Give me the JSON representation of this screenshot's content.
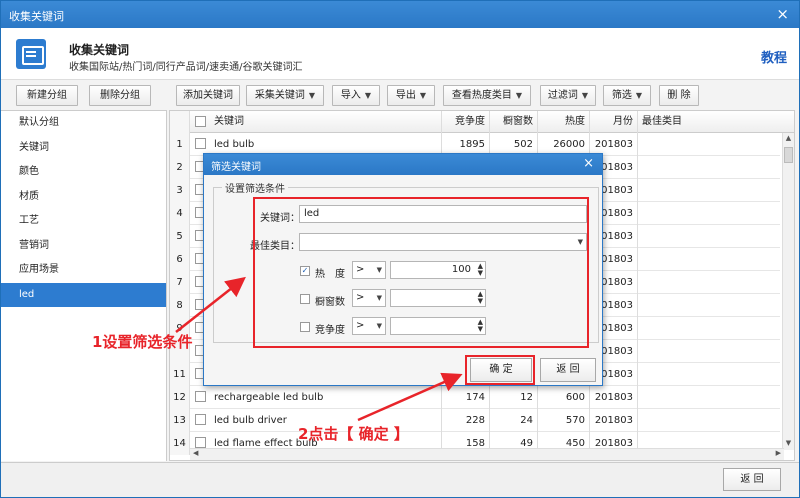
{
  "window": {
    "title": "收集关键词",
    "close_glyph": "×"
  },
  "header": {
    "title": "收集关键词",
    "subtitle": "收集国际站/热门词/同行产品词/速卖通/谷歌关键词汇",
    "tutorial_link": "教程",
    "icon": "keyword-folder-icon"
  },
  "left_toolbar": {
    "new_group": "新建分组",
    "delete_group": "删除分组"
  },
  "toolbar": {
    "add_keyword": "添加关键词",
    "collect_keyword": "采集关键词",
    "import": "导入",
    "export": "导出",
    "view_hot_category": "查看热度类目",
    "filter_words": "过滤词",
    "filter": "筛选",
    "delete": "删 除"
  },
  "groups": [
    {
      "label": "默认分组",
      "active": false
    },
    {
      "label": "关键词",
      "active": false
    },
    {
      "label": "颜色",
      "active": false
    },
    {
      "label": "材质",
      "active": false
    },
    {
      "label": "工艺",
      "active": false
    },
    {
      "label": "营销词",
      "active": false
    },
    {
      "label": "应用场景",
      "active": false
    },
    {
      "label": "led",
      "active": true
    }
  ],
  "table": {
    "headers": {
      "keyword": "关键词",
      "competition": "竞争度",
      "showcase": "橱窗数",
      "heat": "热度",
      "month": "月份",
      "best_category": "最佳类目"
    },
    "rows": [
      {
        "n": "1",
        "keyword": "led bulb",
        "competition": "1895",
        "showcase": "502",
        "heat": "26000",
        "month": "201803"
      },
      {
        "n": "2",
        "keyword": "",
        "competition": "",
        "showcase": "",
        "heat": "",
        "month": "201803"
      },
      {
        "n": "3",
        "keyword": "",
        "competition": "",
        "showcase": "",
        "heat": "",
        "month": "201803"
      },
      {
        "n": "4",
        "keyword": "",
        "competition": "",
        "showcase": "",
        "heat": "",
        "month": "201803"
      },
      {
        "n": "5",
        "keyword": "",
        "competition": "",
        "showcase": "",
        "heat": "",
        "month": "201803"
      },
      {
        "n": "6",
        "keyword": "",
        "competition": "",
        "showcase": "",
        "heat": "",
        "month": "201803"
      },
      {
        "n": "7",
        "keyword": "",
        "competition": "",
        "showcase": "",
        "heat": "",
        "month": "201803"
      },
      {
        "n": "8",
        "keyword": "",
        "competition": "",
        "showcase": "",
        "heat": "",
        "month": "201803"
      },
      {
        "n": "9",
        "keyword": "",
        "competition": "",
        "showcase": "",
        "heat": "",
        "month": "201803"
      },
      {
        "n": "",
        "keyword": "",
        "competition": "",
        "showcase": "",
        "heat": "",
        "month": "201803"
      },
      {
        "n": "11",
        "keyword": "",
        "competition": "",
        "showcase": "",
        "heat": "",
        "month": "201803"
      },
      {
        "n": "12",
        "keyword": "rechargeable led bulb",
        "competition": "174",
        "showcase": "12",
        "heat": "600",
        "month": "201803"
      },
      {
        "n": "13",
        "keyword": "led bulb driver",
        "competition": "228",
        "showcase": "24",
        "heat": "570",
        "month": "201803"
      },
      {
        "n": "14",
        "keyword": "led flame effect bulb",
        "competition": "158",
        "showcase": "49",
        "heat": "450",
        "month": "201803"
      }
    ]
  },
  "dialog": {
    "title": "筛选关键词",
    "close_glyph": "×",
    "section_legend": "设置筛选条件",
    "keyword_label": "关键词：",
    "keyword_value": "led",
    "category_label": "佳类目：",
    "category_label_prefix": "最",
    "heat_label": "热　度",
    "heat_checked": true,
    "heat_op": ">",
    "heat_value": "100",
    "showcase_label": "橱窗数",
    "showcase_checked": false,
    "showcase_op": ">",
    "competition_label": "竞争度",
    "competition_checked": false,
    "competition_op": ">",
    "ok_button": "确 定",
    "back_button": "返 回"
  },
  "bottom": {
    "back_button": "返 回"
  },
  "annotations": {
    "step1": "1设置筛选条件",
    "step2": "2点击【 确定 】",
    "color": "#e8242a"
  }
}
